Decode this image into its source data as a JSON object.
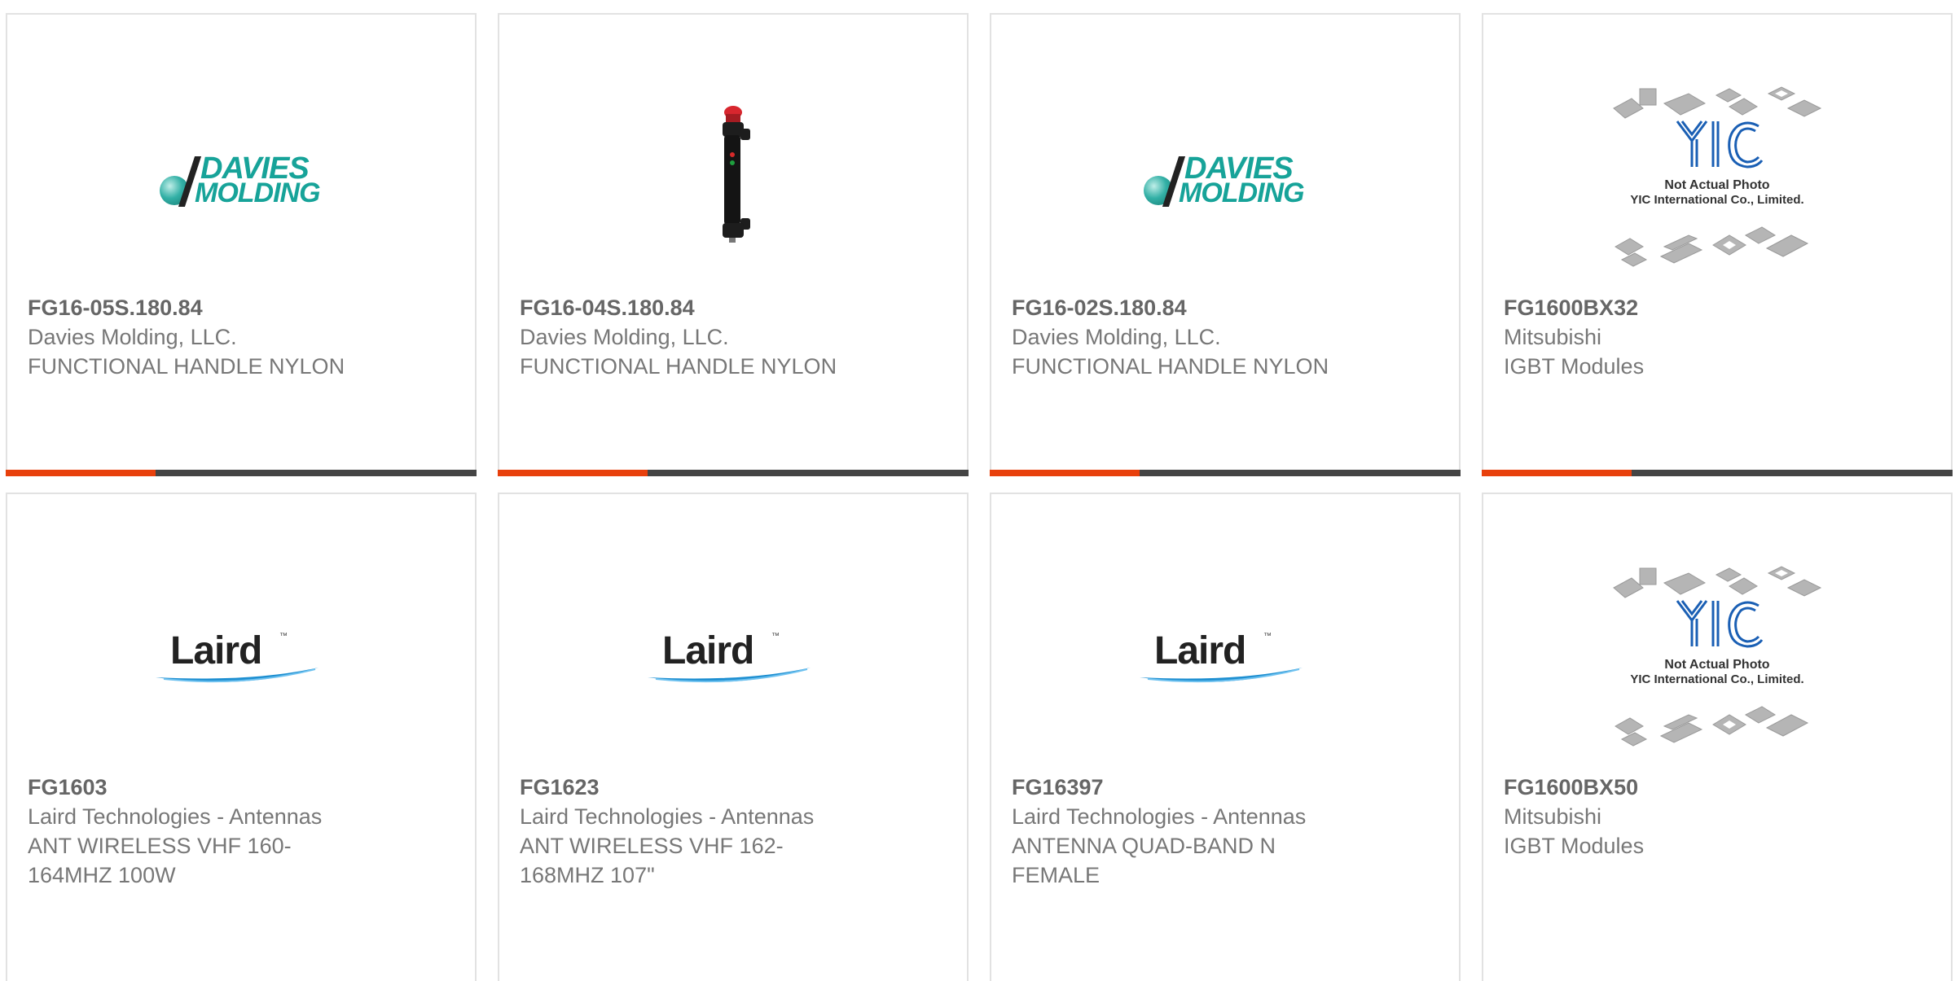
{
  "products": [
    {
      "part_number": "FG16-05S.180.84",
      "manufacturer": "Davies Molding, LLC.",
      "description": "FUNCTIONAL HANDLE NYLON",
      "image": "davies-molding-logo",
      "logo_text": [
        "DAVIES",
        "MOLDING"
      ]
    },
    {
      "part_number": "FG16-04S.180.84",
      "manufacturer": "Davies Molding, LLC.",
      "description": "FUNCTIONAL HANDLE NYLON",
      "image": "functional-handle-photo"
    },
    {
      "part_number": "FG16-02S.180.84",
      "manufacturer": "Davies Molding, LLC.",
      "description": "FUNCTIONAL HANDLE NYLON",
      "image": "davies-molding-logo",
      "logo_text": [
        "DAVIES",
        "MOLDING"
      ]
    },
    {
      "part_number": "FG1600BX32",
      "manufacturer": "Mitsubishi",
      "description": "IGBT Modules",
      "image": "yic-placeholder",
      "logo_text": [
        "YIC"
      ],
      "caption": [
        "Not Actual Photo",
        "YIC International Co., Limited."
      ]
    },
    {
      "part_number": "FG1603",
      "manufacturer": "Laird Technologies - Antennas",
      "description": "ANT WIRELESS VHF 160-164MHZ 100W",
      "image": "laird-logo",
      "logo_text": [
        "Laird"
      ]
    },
    {
      "part_number": "FG1623",
      "manufacturer": "Laird Technologies - Antennas",
      "description": "ANT WIRELESS VHF 162-168MHZ 107\"",
      "image": "laird-logo",
      "logo_text": [
        "Laird"
      ]
    },
    {
      "part_number": "FG16397",
      "manufacturer": "Laird Technologies - Antennas",
      "description": "ANTENNA QUAD-BAND N FEMALE",
      "image": "laird-logo",
      "logo_text": [
        "Laird"
      ]
    },
    {
      "part_number": "FG1600BX50",
      "manufacturer": "Mitsubishi",
      "description": "IGBT Modules",
      "image": "yic-placeholder",
      "logo_text": [
        "YIC"
      ],
      "caption": [
        "Not Actual Photo",
        "YIC International Co., Limited."
      ]
    }
  ],
  "colors": {
    "accent": "#e8400c",
    "bar": "#444444",
    "border": "#e2e2e2",
    "davies_teal": "#17a399",
    "laird_blue": "#1e8fd1"
  }
}
